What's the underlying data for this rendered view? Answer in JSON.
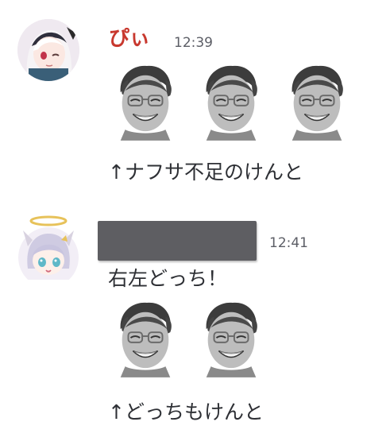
{
  "colors": {
    "name_red": "#c8382e",
    "text": "#2e3035",
    "timestamp": "#5c5e66",
    "redacted_bar": "#5e5e62",
    "halo": "#e7c25a"
  },
  "messages": [
    {
      "author": "ぴぃ",
      "timestamp": "12:39",
      "avatar_icon": "anime-girl-white-hair-avatar",
      "sticker_icon": "grinning-face-photo-sticker",
      "sticker_count": 3,
      "text": "↑ナフサ不足のけんと"
    },
    {
      "author_redacted": true,
      "timestamp": "12:41",
      "avatar_icon": "anime-girl-halo-avatar",
      "sticker_icon": "grinning-face-photo-sticker",
      "sticker_count": 2,
      "text_before": "右左どっち！",
      "text_after": "↑どっちもけんと"
    }
  ]
}
